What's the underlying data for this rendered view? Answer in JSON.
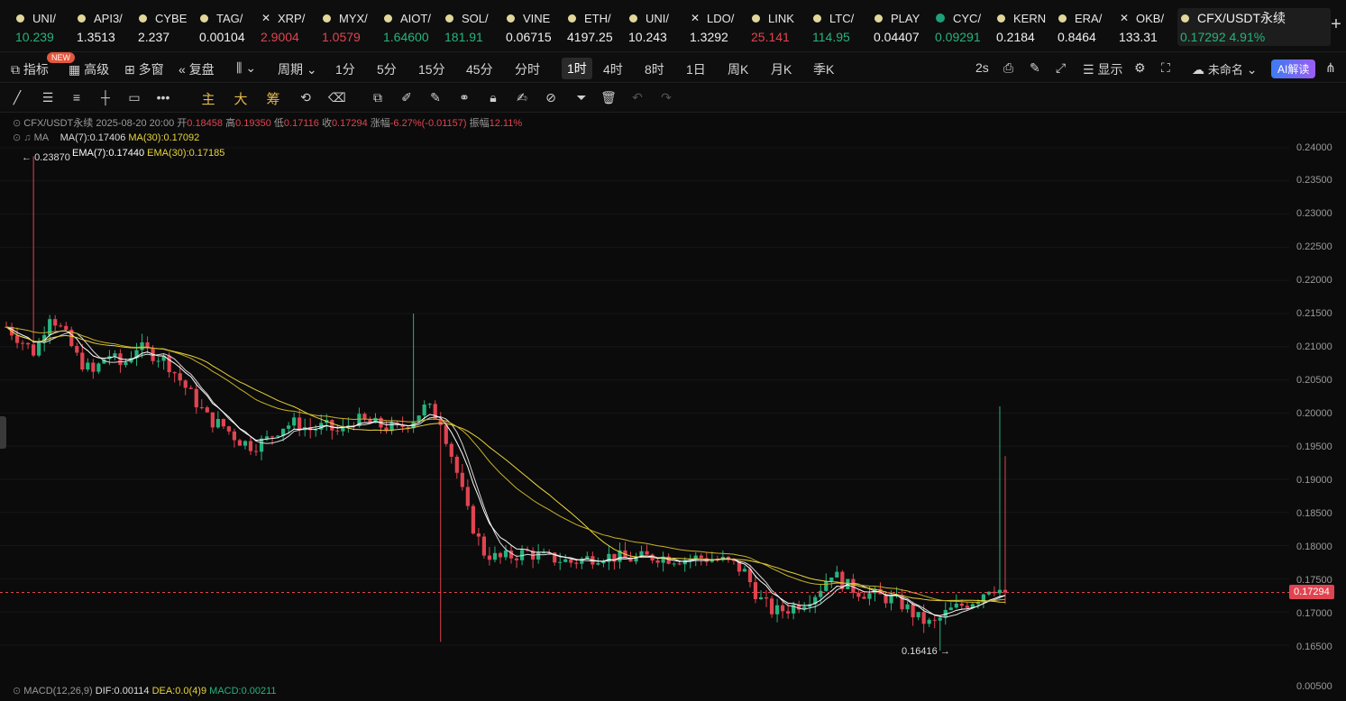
{
  "tickers": [
    {
      "sym": "UNI/",
      "price": "10.239",
      "dir": "up",
      "mark": "dot"
    },
    {
      "sym": "API3/",
      "price": "1.3513",
      "dir": "wt",
      "mark": "dot"
    },
    {
      "sym": "CYBE",
      "price": "2.237",
      "dir": "wt",
      "mark": "dot"
    },
    {
      "sym": "TAG/",
      "price": "0.00104",
      "dir": "wt",
      "mark": "dot"
    },
    {
      "sym": "XRP/",
      "price": "2.9004",
      "dir": "down",
      "mark": "x"
    },
    {
      "sym": "MYX/",
      "price": "1.0579",
      "dir": "down",
      "mark": "dot"
    },
    {
      "sym": "AIOT/",
      "price": "1.64600",
      "dir": "up",
      "mark": "dot"
    },
    {
      "sym": "SOL/",
      "price": "181.91",
      "dir": "up",
      "mark": "dot"
    },
    {
      "sym": "VINE",
      "price": "0.06715",
      "dir": "wt",
      "mark": "dot"
    },
    {
      "sym": "ETH/",
      "price": "4197.25",
      "dir": "wt",
      "mark": "dot"
    },
    {
      "sym": "UNI/",
      "price": "10.243",
      "dir": "wt",
      "mark": "dot"
    },
    {
      "sym": "LDO/",
      "price": "1.3292",
      "dir": "wt",
      "mark": "x"
    },
    {
      "sym": "LINK",
      "price": "25.141",
      "dir": "down",
      "mark": "dot"
    },
    {
      "sym": "LTC/",
      "price": "114.95",
      "dir": "up",
      "mark": "dot"
    },
    {
      "sym": "PLAY",
      "price": "0.04407",
      "dir": "wt",
      "mark": "dot"
    },
    {
      "sym": "CYC/",
      "price": "0.09291",
      "dir": "up",
      "mark": "g"
    },
    {
      "sym": "KERN",
      "price": "0.2184",
      "dir": "wt",
      "mark": "dot"
    },
    {
      "sym": "ERA/",
      "price": "0.8464",
      "dir": "wt",
      "mark": "dot"
    },
    {
      "sym": "OKB/",
      "price": "133.31",
      "dir": "wt",
      "mark": "x"
    }
  ],
  "active_ticker": {
    "sym": "CFX/USDT永续",
    "price": "0.17292",
    "change": "4.91%"
  },
  "plus_label": "+",
  "toolbar": {
    "indicator": "指标",
    "new_badge": "NEW",
    "advanced": "高级",
    "multi": "多窗",
    "replay": "复盘",
    "period": "周期",
    "intervals": [
      "1分",
      "5分",
      "15分",
      "45分",
      "分时",
      "1时",
      "4时",
      "8时",
      "1日",
      "周K",
      "月K",
      "季K"
    ],
    "selected_interval": "1时",
    "refresh": "2s",
    "display": "显示",
    "layout_name": "未命名",
    "ai_button": "AI解读"
  },
  "draw_tools": {
    "main": "主",
    "big": "大",
    "chips": "筹"
  },
  "legend": {
    "pair": "CFX/USDT永续",
    "date": "2025-08-20 20:00",
    "open_label": "开",
    "open": "0.18458",
    "high_label": "高",
    "high": "0.19350",
    "low_label": "低",
    "low": "0.17116",
    "close_label": "收",
    "close": "0.17294",
    "chg_label": "涨幅",
    "chg": "-6.27%(-0.01157)",
    "amp_label": "振幅",
    "amp": "12.11%",
    "ma_name": "MA",
    "ma7": "MA(7):0.17406",
    "ma30": "MA(30):0.17092",
    "ema7": "EMA(7):0.17440",
    "ema30": "EMA(30):0.17185",
    "macd_name": "MACD(12,26,9)",
    "dif": "DIF:0.00114",
    "dea": "DEA:0.0(4)9",
    "macd": "MACD:0.00211"
  },
  "annotations": {
    "high": "0.23870",
    "low": "0.16416"
  },
  "last_price_tag": "0.17294",
  "colors": {
    "up": "#26b37e",
    "down": "#e04451",
    "ma7": "#d9d9d9",
    "ma30": "#e8d43a",
    "ema7": "#ffffff",
    "ema30": "#e8d43a"
  },
  "chart_data": {
    "type": "candlestick",
    "ylim": [
      0.165,
      0.24
    ],
    "yticks": [
      "0.24000",
      "0.23500",
      "0.23000",
      "0.22500",
      "0.22000",
      "0.21500",
      "0.21000",
      "0.20500",
      "0.20000",
      "0.19500",
      "0.19000",
      "0.18500",
      "0.18000",
      "0.17500",
      "0.17000",
      "0.16500",
      "0.00500"
    ],
    "close_series": [
      0.213,
      0.211,
      0.209,
      0.215,
      0.212,
      0.208,
      0.206,
      0.209,
      0.207,
      0.21,
      0.209,
      0.208,
      0.205,
      0.202,
      0.199,
      0.198,
      0.196,
      0.195,
      0.196,
      0.198,
      0.1985,
      0.1975,
      0.198,
      0.197,
      0.199,
      0.1985,
      0.198,
      0.1975,
      0.199,
      0.201,
      0.199,
      0.192,
      0.184,
      0.179,
      0.178,
      0.1785,
      0.179,
      0.1782,
      0.178,
      0.1775,
      0.178,
      0.1785,
      0.1783,
      0.178,
      0.1782,
      0.1784,
      0.1781,
      0.178,
      0.1782,
      0.1779,
      0.1775,
      0.176,
      0.172,
      0.17,
      0.1705,
      0.1715,
      0.173,
      0.176,
      0.174,
      0.173,
      0.1725,
      0.172,
      0.171,
      0.169,
      0.168,
      0.17,
      0.171,
      0.172,
      0.174,
      0.1729
    ],
    "highlights": {
      "peak": 0.2387,
      "trough": 0.16416,
      "last": 0.17294
    }
  }
}
